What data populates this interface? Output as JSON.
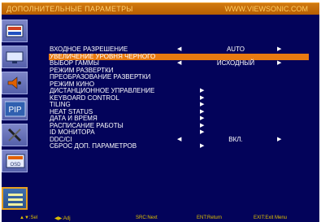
{
  "header": {
    "title": "ДОПОЛНИТЕЛЬНЫЕ ПАРАМЕТРЫ",
    "site": "WWW.VIEWSONIC.COM"
  },
  "tabs": [
    {
      "icon": "picture-icon"
    },
    {
      "icon": "monitor-icon"
    },
    {
      "icon": "audio-icon"
    },
    {
      "icon": "pip-icon",
      "label": "PIP"
    },
    {
      "icon": "tools-icon"
    },
    {
      "icon": "osd-icon",
      "label": "OSD"
    },
    {
      "icon": "advanced-menu-icon"
    }
  ],
  "menu": [
    {
      "label": "ВХОДНОЕ РАЗРЕШЕНИЕ",
      "value": "AUTO",
      "arrows": true
    },
    {
      "label": "УВЕЛИЧЕНИЕ УРОВНЯ ЧЕРНОГО",
      "selected": true
    },
    {
      "label": "ВЫБОР ГАММЫ",
      "value": "ИСХОДНЫЙ",
      "arrows": true
    },
    {
      "label": "РЕЖИМ РАЗВЕРТКИ"
    },
    {
      "label": "ПРЕОБРАЗОВАНИЕ РАЗВЕРТКИ"
    },
    {
      "label": "РЕЖИМ КИНО"
    },
    {
      "label": "ДИСТАНЦИОННОЕ УПРАВЛЕНИЕ",
      "submenu": true
    },
    {
      "label": "KEYBOARD CONTROL",
      "submenu": true
    },
    {
      "label": "TILING",
      "submenu": true
    },
    {
      "label": "HEAT STATUS",
      "submenu": true
    },
    {
      "label": "ДАТА И ВРЕМЯ",
      "submenu": true
    },
    {
      "label": "РАСПИСАНИЕ РАБОТЫ",
      "submenu": true
    },
    {
      "label": "ID МОНИТОРА",
      "submenu": true
    },
    {
      "label": "DDC/CI",
      "value": "ВКЛ.",
      "arrows": true
    },
    {
      "label": "СБРОС ДОП. ПАРАМЕТРОВ",
      "submenu": true
    }
  ],
  "footer": [
    {
      "label": "▲▼:Sel"
    },
    {
      "label": "◀▶:Adj"
    },
    {
      "label": "SRC:Next"
    },
    {
      "label": "ENT:Return"
    },
    {
      "label": "EXIT:Exit Menu"
    }
  ],
  "colors": {
    "background": "#03035a",
    "highlight": "#e87a10",
    "header": "#c06a00",
    "footer_text": "#e0c000"
  }
}
